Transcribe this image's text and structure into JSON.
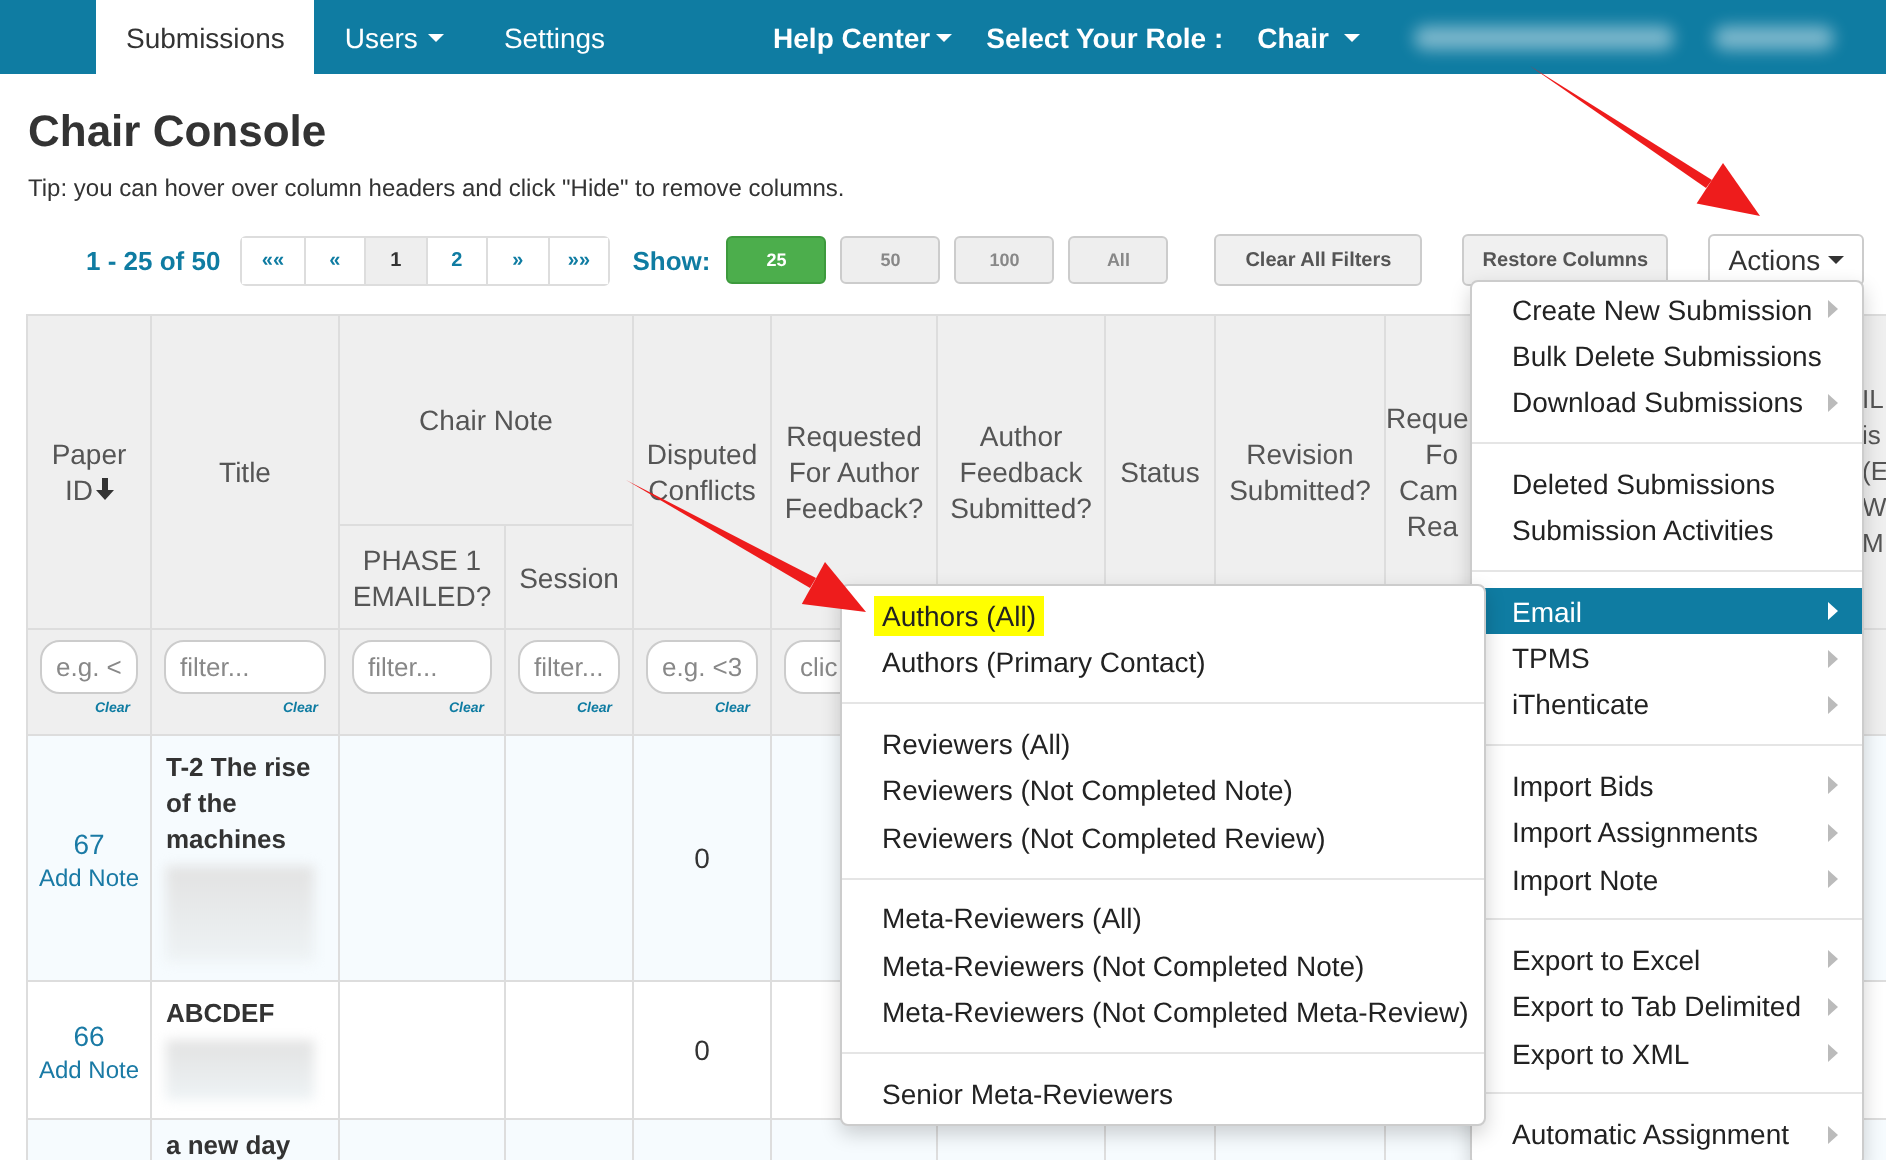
{
  "nav": {
    "tabs": [
      {
        "label": "Submissions",
        "selected": true,
        "dropdown": false
      },
      {
        "label": "Users",
        "selected": false,
        "dropdown": true
      },
      {
        "label": "Settings",
        "selected": false,
        "dropdown": false
      }
    ],
    "help": "Help Center",
    "role_label": "Select Your Role :",
    "role": "Chair",
    "account_redacted": true
  },
  "page": {
    "title": "Chair Console",
    "tip": "Tip: you can hover over column headers and click \"Hide\" to remove columns."
  },
  "pagination": {
    "range": "1 - 25 of 50",
    "pages": [
      {
        "label": "««",
        "selected": false
      },
      {
        "label": "«",
        "selected": false
      },
      {
        "label": "1",
        "selected": true
      },
      {
        "label": "2",
        "selected": false
      },
      {
        "label": "»",
        "selected": false
      },
      {
        "label": "»»",
        "selected": false
      }
    ]
  },
  "show": {
    "label": "Show:",
    "options": [
      {
        "label": "25",
        "selected": true
      },
      {
        "label": "50",
        "selected": false
      },
      {
        "label": "100",
        "selected": false
      },
      {
        "label": "All",
        "selected": false
      }
    ]
  },
  "buttons": {
    "clear_filters": "Clear All Filters",
    "restore_columns": "Restore Columns",
    "actions": "Actions"
  },
  "table": {
    "columns": [
      {
        "label": "Paper ID",
        "sorted": true
      },
      {
        "label": "Title"
      },
      {
        "label": "Chair Note",
        "children": [
          {
            "label": "PHASE 1 EMAILED?"
          },
          {
            "label": "Session"
          }
        ]
      },
      {
        "label": "Disputed Conflicts"
      },
      {
        "label": "Requested For Author Feedback?"
      },
      {
        "label": "Author Feedback Submitted?"
      },
      {
        "label": "Status"
      },
      {
        "label": "Revision Submitted?"
      },
      {
        "label": "Reque\nFo\nCam\nRea"
      },
      {
        "label": "IL\nis\n(E\nW\nM"
      }
    ],
    "filters": [
      {
        "placeholder": "e.g. <",
        "clear": "Clear"
      },
      {
        "placeholder": "filter...",
        "clear": "Clear"
      },
      {
        "placeholder": "filter...",
        "clear": "Clear"
      },
      {
        "placeholder": "filter...",
        "clear": "Clear"
      },
      {
        "placeholder": "e.g. <3",
        "clear": "Clear"
      },
      {
        "placeholder": "clic"
      }
    ],
    "rows": [
      {
        "id": "67",
        "note": "Add Note",
        "title": "T-2 The rise of the machines",
        "authors_redacted": true,
        "disputed": "0"
      },
      {
        "id": "66",
        "note": "Add Note",
        "title": "ABCDEF",
        "authors_redacted": true,
        "disputed": "0"
      },
      {
        "title": "a new day"
      }
    ]
  },
  "actions_menu": {
    "sections": [
      [
        {
          "label": "Create New Submission",
          "submenu": true,
          "selected": false
        },
        {
          "label": "Bulk Delete Submissions",
          "submenu": false,
          "selected": false
        },
        {
          "label": "Download Submissions",
          "submenu": true,
          "selected": false
        }
      ],
      [
        {
          "label": "Deleted Submissions",
          "submenu": false,
          "selected": false
        },
        {
          "label": "Submission Activities",
          "submenu": false,
          "selected": false
        }
      ],
      [
        {
          "label": "Email",
          "submenu": true,
          "selected": true
        },
        {
          "label": "TPMS",
          "submenu": true,
          "selected": false
        },
        {
          "label": "iThenticate",
          "submenu": true,
          "selected": false
        }
      ],
      [
        {
          "label": "Import Bids",
          "submenu": true,
          "selected": false
        },
        {
          "label": "Import Assignments",
          "submenu": true,
          "selected": false
        },
        {
          "label": "Import Note",
          "submenu": true,
          "selected": false
        }
      ],
      [
        {
          "label": "Export to Excel",
          "submenu": true,
          "selected": false
        },
        {
          "label": "Export to Tab Delimited",
          "submenu": true,
          "selected": false
        },
        {
          "label": "Export to XML",
          "submenu": true,
          "selected": false
        }
      ],
      [
        {
          "label": "Automatic Assignment",
          "submenu": true,
          "selected": false
        }
      ]
    ]
  },
  "email_menu": {
    "sections": [
      [
        {
          "label": "Authors (All)",
          "highlighted": true
        },
        {
          "label": "Authors (Primary Contact)",
          "highlighted": false
        }
      ],
      [
        {
          "label": "Reviewers (All)",
          "highlighted": false
        },
        {
          "label": "Reviewers (Not Completed Note)",
          "highlighted": false
        },
        {
          "label": "Reviewers (Not Completed Review)",
          "highlighted": false
        }
      ],
      [
        {
          "label": "Meta-Reviewers (All)",
          "highlighted": false
        },
        {
          "label": "Meta-Reviewers (Not Completed Note)",
          "highlighted": false
        },
        {
          "label": "Meta-Reviewers (Not Completed Meta-Review)",
          "highlighted": false
        }
      ],
      [
        {
          "label": "Senior Meta-Reviewers",
          "highlighted": false
        }
      ]
    ]
  }
}
